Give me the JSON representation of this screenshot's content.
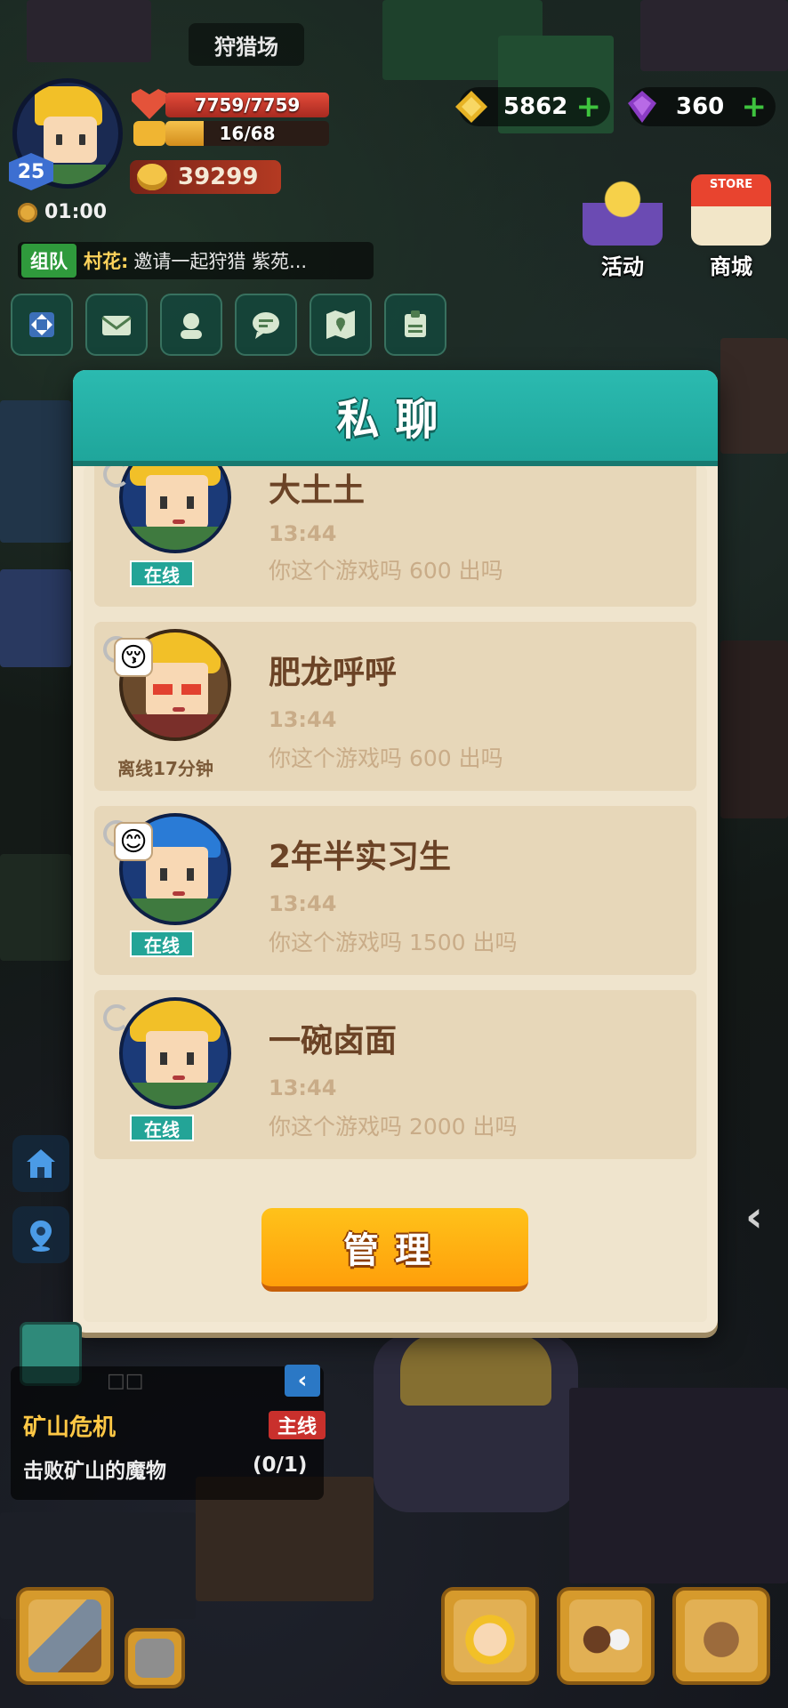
{
  "hud": {
    "location": "狩猎场",
    "level": "25",
    "hp": "7759/7759",
    "energy": "16/68",
    "energy_fraction": 0.235,
    "gold": "39299",
    "timer": "01:00",
    "team_tag": "组队",
    "team_sender": "村花:",
    "team_message": "邀请一起狩猎 紫苑...",
    "gems_yellow": "5862",
    "gems_purple": "360",
    "activity_label": "活动",
    "store_label": "商城",
    "store_sign": "STORE"
  },
  "dialog": {
    "title": "私聊",
    "manage_label": "管理",
    "chats": [
      {
        "name": "大土土",
        "time": "13:44",
        "message": "你这个游戏吗  600 出吗",
        "status": "在线"
      },
      {
        "name": "肥龙呼呼",
        "time": "13:44",
        "message": "你这个游戏吗  600 出吗",
        "status": "离线17分钟",
        "emoji": "😚"
      },
      {
        "name": "2年半实习生",
        "time": "13:44",
        "message": "你这个游戏吗  1500 出吗",
        "status": "在线",
        "emoji": "😊"
      },
      {
        "name": "一碗卤面",
        "time": "13:44",
        "message": "你这个游戏吗  2000 出吗",
        "status": "在线"
      }
    ]
  },
  "quest": {
    "title": "矿山危机",
    "tag": "主线",
    "description": "击败矿山的魔物",
    "progress": "(0/1)",
    "collapse_icon": "‹",
    "dots": "□□"
  },
  "colors": {
    "teal_header": "#1fa69b",
    "dialog_bg": "#f3e8d3",
    "row_bg": "#e7d7b9",
    "manage_orange": "#ff9f0a",
    "online_teal": "#23a497"
  }
}
